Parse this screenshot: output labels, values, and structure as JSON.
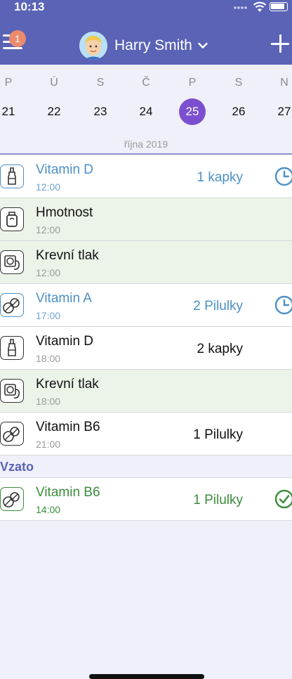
{
  "status_bar": {
    "time": "10:13"
  },
  "header": {
    "menu_badge": "1",
    "user_name": "Harry Smith",
    "menu_icon": "hamburger-icon",
    "add_icon": "plus-icon",
    "dropdown_icon": "chevron-down-icon"
  },
  "calendar": {
    "days": [
      {
        "letter": "P",
        "number": "21"
      },
      {
        "letter": "Ú",
        "number": "22"
      },
      {
        "letter": "S",
        "number": "23"
      },
      {
        "letter": "Č",
        "number": "24"
      },
      {
        "letter": "P",
        "number": "25",
        "selected": true
      },
      {
        "letter": "S",
        "number": "26"
      },
      {
        "letter": "N",
        "number": "27"
      }
    ],
    "month_label": "října 2019",
    "selected_color": "#7c4fd0"
  },
  "entries": [
    {
      "title": "Vitamin D",
      "time": "12:00",
      "amount": "1 kapky",
      "icon": "dropper-bottle-icon",
      "state": "pending-reminder"
    },
    {
      "title": "Hmotnost",
      "time": "12:00",
      "amount": "",
      "icon": "weight-icon",
      "state": "measurement"
    },
    {
      "title": "Krevní tlak",
      "time": "12:00",
      "amount": "",
      "icon": "blood-pressure-icon",
      "state": "measurement"
    },
    {
      "title": "Vitamin A",
      "time": "17:00",
      "amount": "2 Pilulky",
      "icon": "pills-icon",
      "state": "pending-reminder"
    },
    {
      "title": "Vitamin D",
      "time": "18:00",
      "amount": "2 kapky",
      "icon": "dropper-bottle-icon",
      "state": "scheduled"
    },
    {
      "title": "Krevní tlak",
      "time": "18:00",
      "amount": "",
      "icon": "blood-pressure-icon",
      "state": "measurement"
    },
    {
      "title": "Vitamin B6",
      "time": "21:00",
      "amount": "1 Pilulky",
      "icon": "pills-icon",
      "state": "scheduled"
    }
  ],
  "taken_section": {
    "label": "Vzato",
    "entries": [
      {
        "title": "Vitamin B6",
        "time": "14:00",
        "amount": "1 Pilulky",
        "icon": "pills-icon",
        "state": "taken"
      }
    ]
  },
  "colors": {
    "header_bg": "#5a63b5",
    "reminder_blue": "#4d90c7",
    "taken_green": "#3c8d3c",
    "measurement_bg": "#ecf4ea",
    "badge": "#ec8a6c"
  }
}
